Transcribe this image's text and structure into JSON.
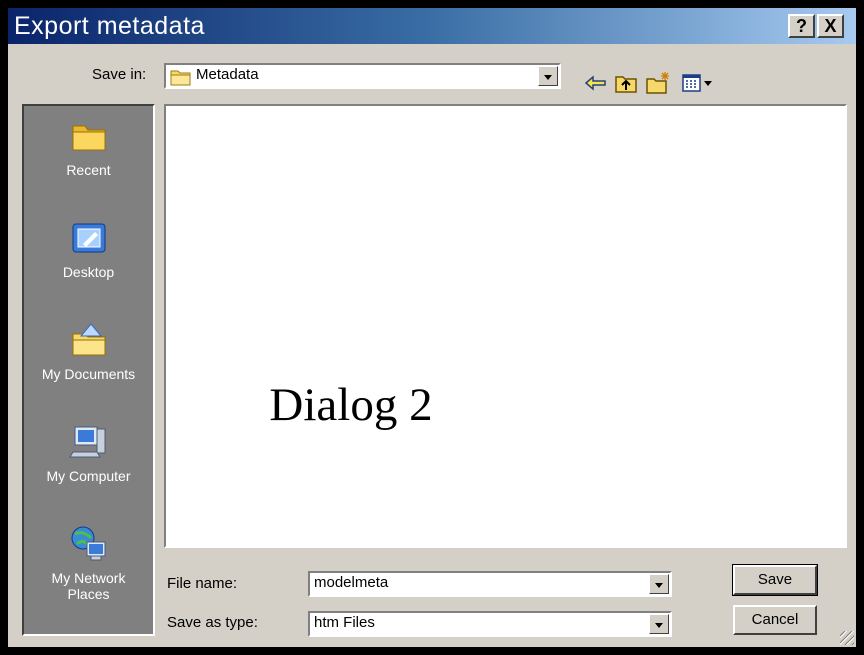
{
  "window": {
    "title": "Export metadata"
  },
  "titlebar_buttons": {
    "help": "?",
    "close": "X"
  },
  "save_in": {
    "label": "Save in:",
    "value": "Metadata"
  },
  "toolbar": {
    "icons": [
      "back-arrow-icon",
      "up-folder-icon",
      "new-folder-icon",
      "view-menu-icon"
    ]
  },
  "places": [
    {
      "label": "Recent",
      "icon": "recent-folder-icon"
    },
    {
      "label": "Desktop",
      "icon": "desktop-icon"
    },
    {
      "label": "My Documents",
      "icon": "my-documents-icon"
    },
    {
      "label": "My Computer",
      "icon": "my-computer-icon"
    },
    {
      "label": "My Network Places",
      "label_line1": "My Network",
      "label_line2": "Places",
      "icon": "network-places-icon"
    }
  ],
  "overlay_text": "Dialog 2",
  "file_name": {
    "label": "File name:",
    "value": "modelmeta"
  },
  "save_as_type": {
    "label": "Save as type:",
    "value": "htm Files"
  },
  "buttons": {
    "save": "Save",
    "cancel": "Cancel"
  },
  "colors": {
    "title_start": "#0a246a",
    "title_end": "#a6caf0",
    "face": "#d4d0c8",
    "places_bg": "#808080"
  }
}
